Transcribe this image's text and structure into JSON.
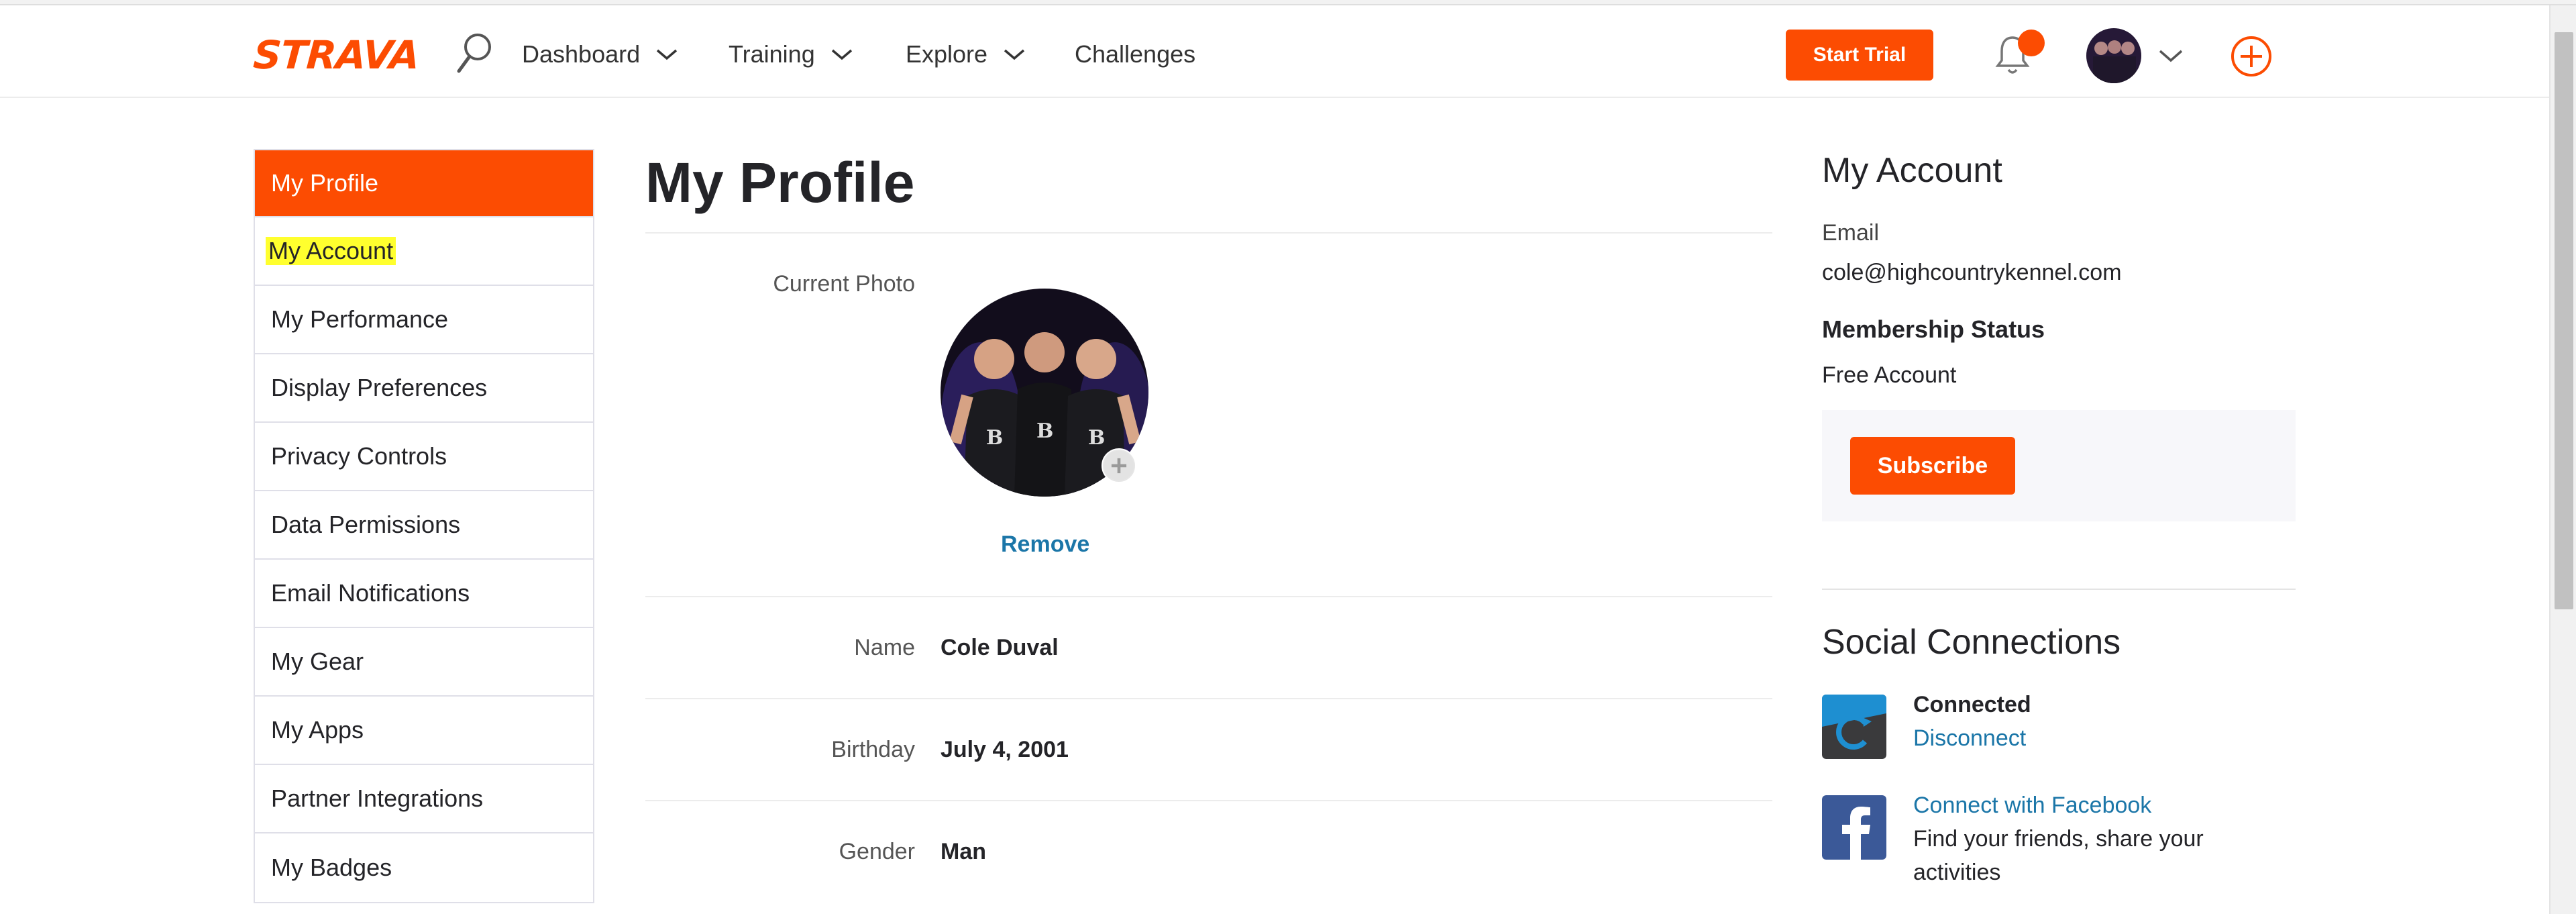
{
  "header": {
    "logo": "STRAVA",
    "nav": [
      "Dashboard",
      "Training",
      "Explore",
      "Challenges"
    ],
    "start_trial": "Start Trial",
    "brand_color": "#fc4c02"
  },
  "sidebar": {
    "items": [
      {
        "label": "My Profile"
      },
      {
        "label": "My Account"
      },
      {
        "label": "My Performance"
      },
      {
        "label": "Display Preferences"
      },
      {
        "label": "Privacy Controls"
      },
      {
        "label": "Data Permissions"
      },
      {
        "label": "Email Notifications"
      },
      {
        "label": "My Gear"
      },
      {
        "label": "My Apps"
      },
      {
        "label": "Partner Integrations"
      },
      {
        "label": "My Badges"
      }
    ]
  },
  "main": {
    "title": "My Profile",
    "current_photo_label": "Current Photo",
    "remove_label": "Remove",
    "fields": [
      {
        "label": "Name",
        "value": "Cole Duval"
      },
      {
        "label": "Birthday",
        "value": "July 4, 2001"
      },
      {
        "label": "Gender",
        "value": "Man"
      }
    ]
  },
  "account": {
    "title": "My Account",
    "email_label": "Email",
    "email": "cole@highcountrykennel.com",
    "membership_label": "Membership Status",
    "membership": "Free Account",
    "subscribe_label": "Subscribe"
  },
  "social": {
    "title": "Social Connections",
    "garmin": {
      "status": "Connected",
      "action": "Disconnect"
    },
    "facebook": {
      "action": "Connect with Facebook",
      "desc": "Find your friends, share your activities"
    }
  }
}
